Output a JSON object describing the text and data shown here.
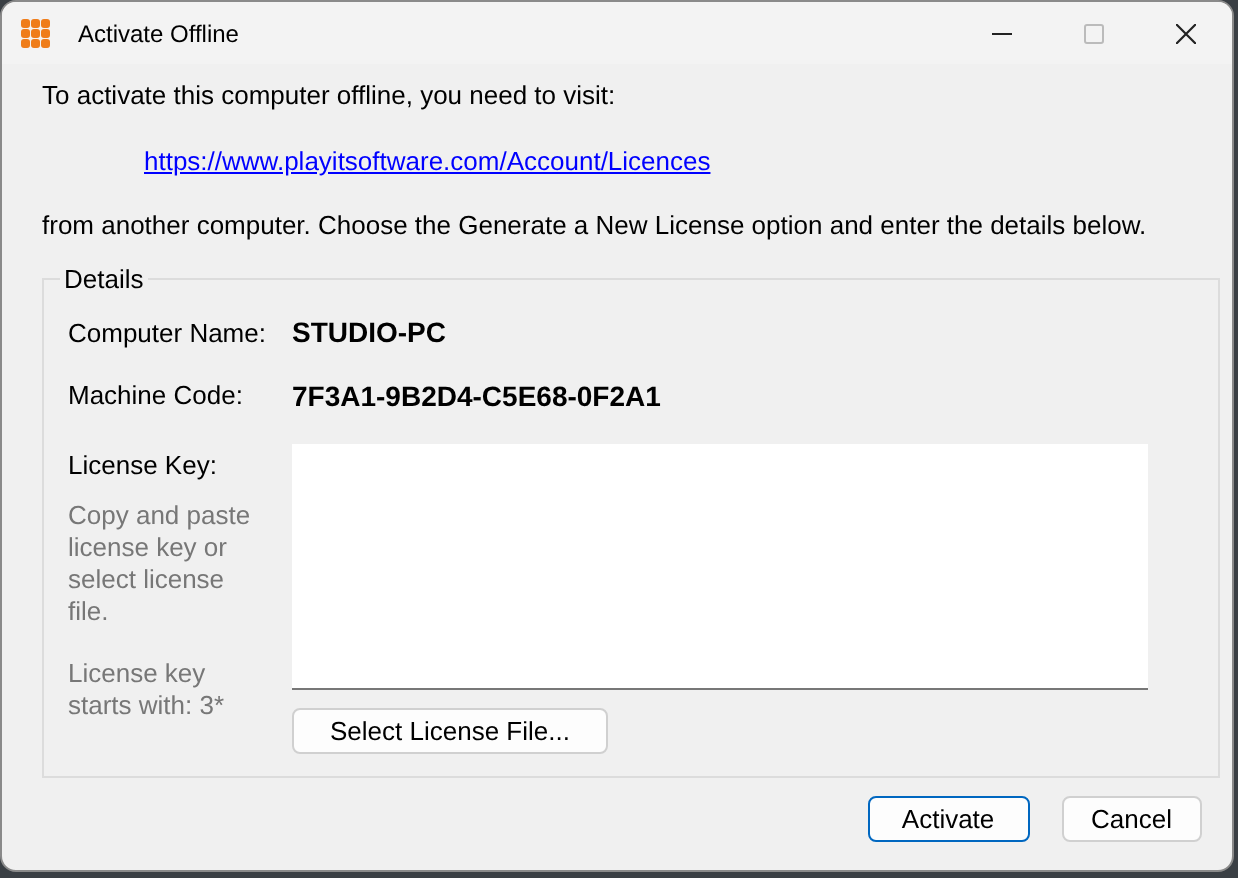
{
  "window": {
    "title": "Activate Offline"
  },
  "intro": "To activate this computer offline, you need to visit:",
  "link": "https://www.playitsoftware.com/Account/Licences",
  "instructions": "from another computer. Choose the Generate a New License option and enter the details below.",
  "details": {
    "legend": "Details",
    "fields": [
      {
        "label": "Computer Name:",
        "value": "STUDIO-PC"
      },
      {
        "label": "Machine Code:",
        "value": "7F3A1-9B2D4-C5E68-0F2A1"
      }
    ],
    "license_label": "License Key:",
    "hint": "Copy and paste license key or select license file.",
    "prefix_hint": "License key starts with: 3*",
    "select_button": "Select License File..."
  },
  "buttons": [
    {
      "label": "Activate",
      "default": true
    },
    {
      "label": "Cancel",
      "default": false
    }
  ]
}
